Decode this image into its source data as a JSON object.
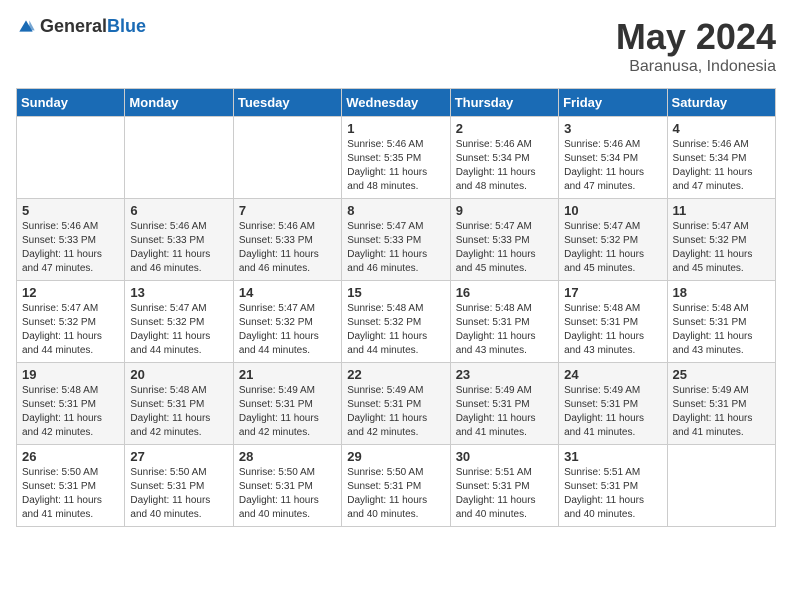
{
  "header": {
    "logo_general": "General",
    "logo_blue": "Blue",
    "month_title": "May 2024",
    "location": "Baranusa, Indonesia"
  },
  "days_of_week": [
    "Sunday",
    "Monday",
    "Tuesday",
    "Wednesday",
    "Thursday",
    "Friday",
    "Saturday"
  ],
  "weeks": [
    [
      {
        "day": "",
        "info": ""
      },
      {
        "day": "",
        "info": ""
      },
      {
        "day": "",
        "info": ""
      },
      {
        "day": "1",
        "info": "Sunrise: 5:46 AM\nSunset: 5:35 PM\nDaylight: 11 hours and 48 minutes."
      },
      {
        "day": "2",
        "info": "Sunrise: 5:46 AM\nSunset: 5:34 PM\nDaylight: 11 hours and 48 minutes."
      },
      {
        "day": "3",
        "info": "Sunrise: 5:46 AM\nSunset: 5:34 PM\nDaylight: 11 hours and 47 minutes."
      },
      {
        "day": "4",
        "info": "Sunrise: 5:46 AM\nSunset: 5:34 PM\nDaylight: 11 hours and 47 minutes."
      }
    ],
    [
      {
        "day": "5",
        "info": "Sunrise: 5:46 AM\nSunset: 5:33 PM\nDaylight: 11 hours and 47 minutes."
      },
      {
        "day": "6",
        "info": "Sunrise: 5:46 AM\nSunset: 5:33 PM\nDaylight: 11 hours and 46 minutes."
      },
      {
        "day": "7",
        "info": "Sunrise: 5:46 AM\nSunset: 5:33 PM\nDaylight: 11 hours and 46 minutes."
      },
      {
        "day": "8",
        "info": "Sunrise: 5:47 AM\nSunset: 5:33 PM\nDaylight: 11 hours and 46 minutes."
      },
      {
        "day": "9",
        "info": "Sunrise: 5:47 AM\nSunset: 5:33 PM\nDaylight: 11 hours and 45 minutes."
      },
      {
        "day": "10",
        "info": "Sunrise: 5:47 AM\nSunset: 5:32 PM\nDaylight: 11 hours and 45 minutes."
      },
      {
        "day": "11",
        "info": "Sunrise: 5:47 AM\nSunset: 5:32 PM\nDaylight: 11 hours and 45 minutes."
      }
    ],
    [
      {
        "day": "12",
        "info": "Sunrise: 5:47 AM\nSunset: 5:32 PM\nDaylight: 11 hours and 44 minutes."
      },
      {
        "day": "13",
        "info": "Sunrise: 5:47 AM\nSunset: 5:32 PM\nDaylight: 11 hours and 44 minutes."
      },
      {
        "day": "14",
        "info": "Sunrise: 5:47 AM\nSunset: 5:32 PM\nDaylight: 11 hours and 44 minutes."
      },
      {
        "day": "15",
        "info": "Sunrise: 5:48 AM\nSunset: 5:32 PM\nDaylight: 11 hours and 44 minutes."
      },
      {
        "day": "16",
        "info": "Sunrise: 5:48 AM\nSunset: 5:31 PM\nDaylight: 11 hours and 43 minutes."
      },
      {
        "day": "17",
        "info": "Sunrise: 5:48 AM\nSunset: 5:31 PM\nDaylight: 11 hours and 43 minutes."
      },
      {
        "day": "18",
        "info": "Sunrise: 5:48 AM\nSunset: 5:31 PM\nDaylight: 11 hours and 43 minutes."
      }
    ],
    [
      {
        "day": "19",
        "info": "Sunrise: 5:48 AM\nSunset: 5:31 PM\nDaylight: 11 hours and 42 minutes."
      },
      {
        "day": "20",
        "info": "Sunrise: 5:48 AM\nSunset: 5:31 PM\nDaylight: 11 hours and 42 minutes."
      },
      {
        "day": "21",
        "info": "Sunrise: 5:49 AM\nSunset: 5:31 PM\nDaylight: 11 hours and 42 minutes."
      },
      {
        "day": "22",
        "info": "Sunrise: 5:49 AM\nSunset: 5:31 PM\nDaylight: 11 hours and 42 minutes."
      },
      {
        "day": "23",
        "info": "Sunrise: 5:49 AM\nSunset: 5:31 PM\nDaylight: 11 hours and 41 minutes."
      },
      {
        "day": "24",
        "info": "Sunrise: 5:49 AM\nSunset: 5:31 PM\nDaylight: 11 hours and 41 minutes."
      },
      {
        "day": "25",
        "info": "Sunrise: 5:49 AM\nSunset: 5:31 PM\nDaylight: 11 hours and 41 minutes."
      }
    ],
    [
      {
        "day": "26",
        "info": "Sunrise: 5:50 AM\nSunset: 5:31 PM\nDaylight: 11 hours and 41 minutes."
      },
      {
        "day": "27",
        "info": "Sunrise: 5:50 AM\nSunset: 5:31 PM\nDaylight: 11 hours and 40 minutes."
      },
      {
        "day": "28",
        "info": "Sunrise: 5:50 AM\nSunset: 5:31 PM\nDaylight: 11 hours and 40 minutes."
      },
      {
        "day": "29",
        "info": "Sunrise: 5:50 AM\nSunset: 5:31 PM\nDaylight: 11 hours and 40 minutes."
      },
      {
        "day": "30",
        "info": "Sunrise: 5:51 AM\nSunset: 5:31 PM\nDaylight: 11 hours and 40 minutes."
      },
      {
        "day": "31",
        "info": "Sunrise: 5:51 AM\nSunset: 5:31 PM\nDaylight: 11 hours and 40 minutes."
      },
      {
        "day": "",
        "info": ""
      }
    ]
  ]
}
